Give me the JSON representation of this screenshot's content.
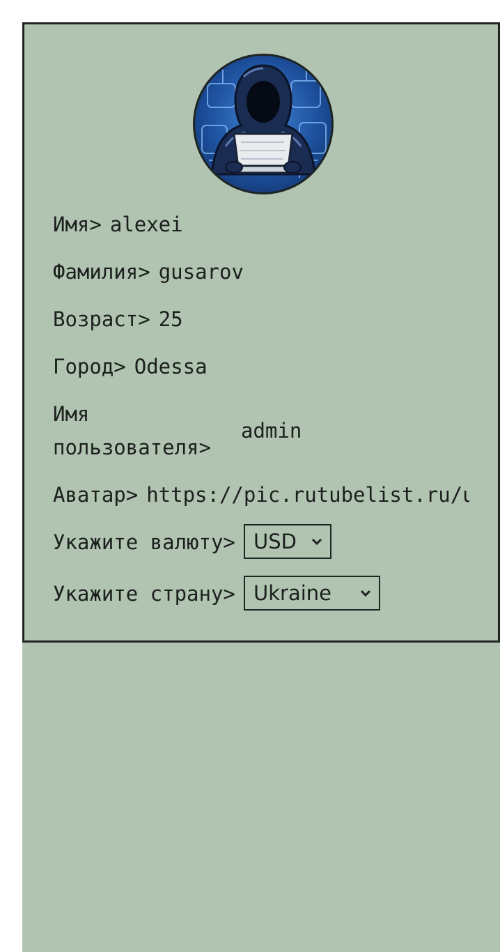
{
  "profile": {
    "first_name": {
      "label": "Имя>",
      "value": "alexei"
    },
    "last_name": {
      "label": "Фамилия>",
      "value": "gusarov"
    },
    "age": {
      "label": "Возраст>",
      "value": "25"
    },
    "city": {
      "label": "Город>",
      "value": "Odessa"
    },
    "username": {
      "label": "Имя пользователя>",
      "value": "admin"
    },
    "avatar": {
      "label": "Аватар>",
      "value": "https://pic.rutubelist.ru/u"
    },
    "currency": {
      "label": "Укажите валюту>",
      "selected": "USD"
    },
    "country": {
      "label": "Укажите страну>",
      "selected": "Ukraine"
    }
  },
  "avatar_image": {
    "icon": "hacker-avatar-icon"
  },
  "colors": {
    "background": "#b1c4b1",
    "border": "#1e2421",
    "text": "#1b1f1d"
  }
}
